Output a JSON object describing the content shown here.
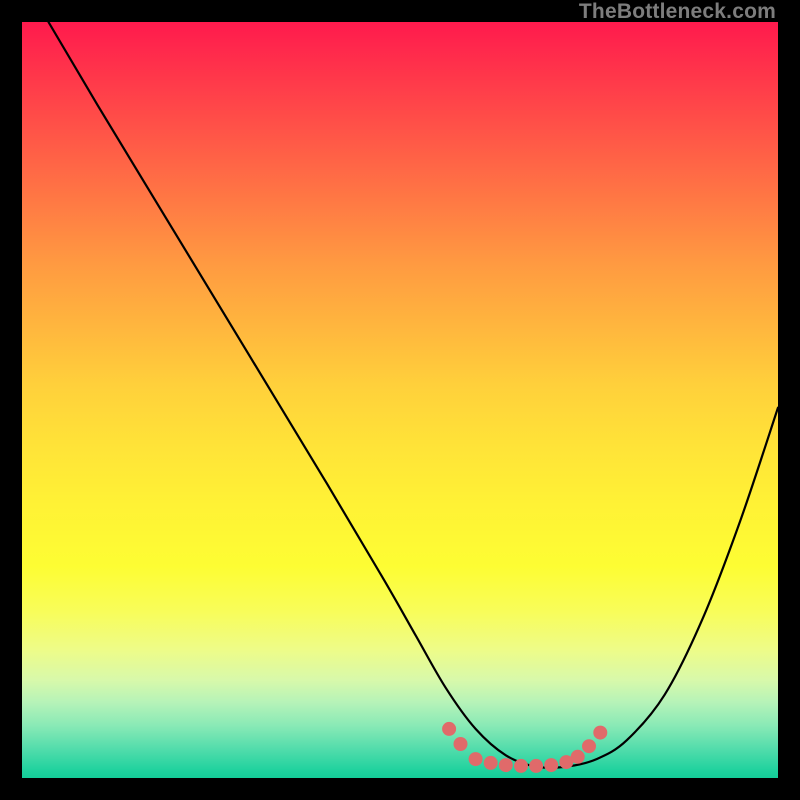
{
  "watermark": {
    "text": "TheBottleneck.com"
  },
  "colors": {
    "frame": "#000000",
    "curve": "#000000",
    "marker_fill": "#e06a6a",
    "marker_stroke": "#d85a5a"
  },
  "chart_data": {
    "type": "line",
    "title": "",
    "xlabel": "",
    "ylabel": "",
    "xlim": [
      0,
      100
    ],
    "ylim": [
      0,
      100
    ],
    "legend": false,
    "grid": false,
    "note": "Axes unlabeled in source; values are relative percentages read from pixel geometry (x along width, y = depth from top).",
    "series": [
      {
        "name": "bottleneck-curve",
        "x": [
          3.5,
          10,
          20,
          30,
          40,
          48,
          52,
          56,
          60,
          64,
          68,
          72,
          76,
          80,
          85,
          90,
          95,
          100
        ],
        "y": [
          100,
          89,
          72.5,
          56,
          39.5,
          26,
          19,
          12,
          6.5,
          3,
          1.5,
          1.5,
          2.5,
          5,
          11,
          21,
          34,
          49
        ]
      }
    ],
    "markers": {
      "name": "bottom-cluster",
      "note": "Salmon dots along the trough of the curve",
      "points": [
        {
          "x": 56.5,
          "y": 6.5
        },
        {
          "x": 58.0,
          "y": 4.5
        },
        {
          "x": 60.0,
          "y": 2.5
        },
        {
          "x": 62.0,
          "y": 2.0
        },
        {
          "x": 64.0,
          "y": 1.7
        },
        {
          "x": 66.0,
          "y": 1.6
        },
        {
          "x": 68.0,
          "y": 1.6
        },
        {
          "x": 70.0,
          "y": 1.7
        },
        {
          "x": 72.0,
          "y": 2.1
        },
        {
          "x": 73.5,
          "y": 2.8
        },
        {
          "x": 75.0,
          "y": 4.2
        },
        {
          "x": 76.5,
          "y": 6.0
        }
      ]
    }
  }
}
